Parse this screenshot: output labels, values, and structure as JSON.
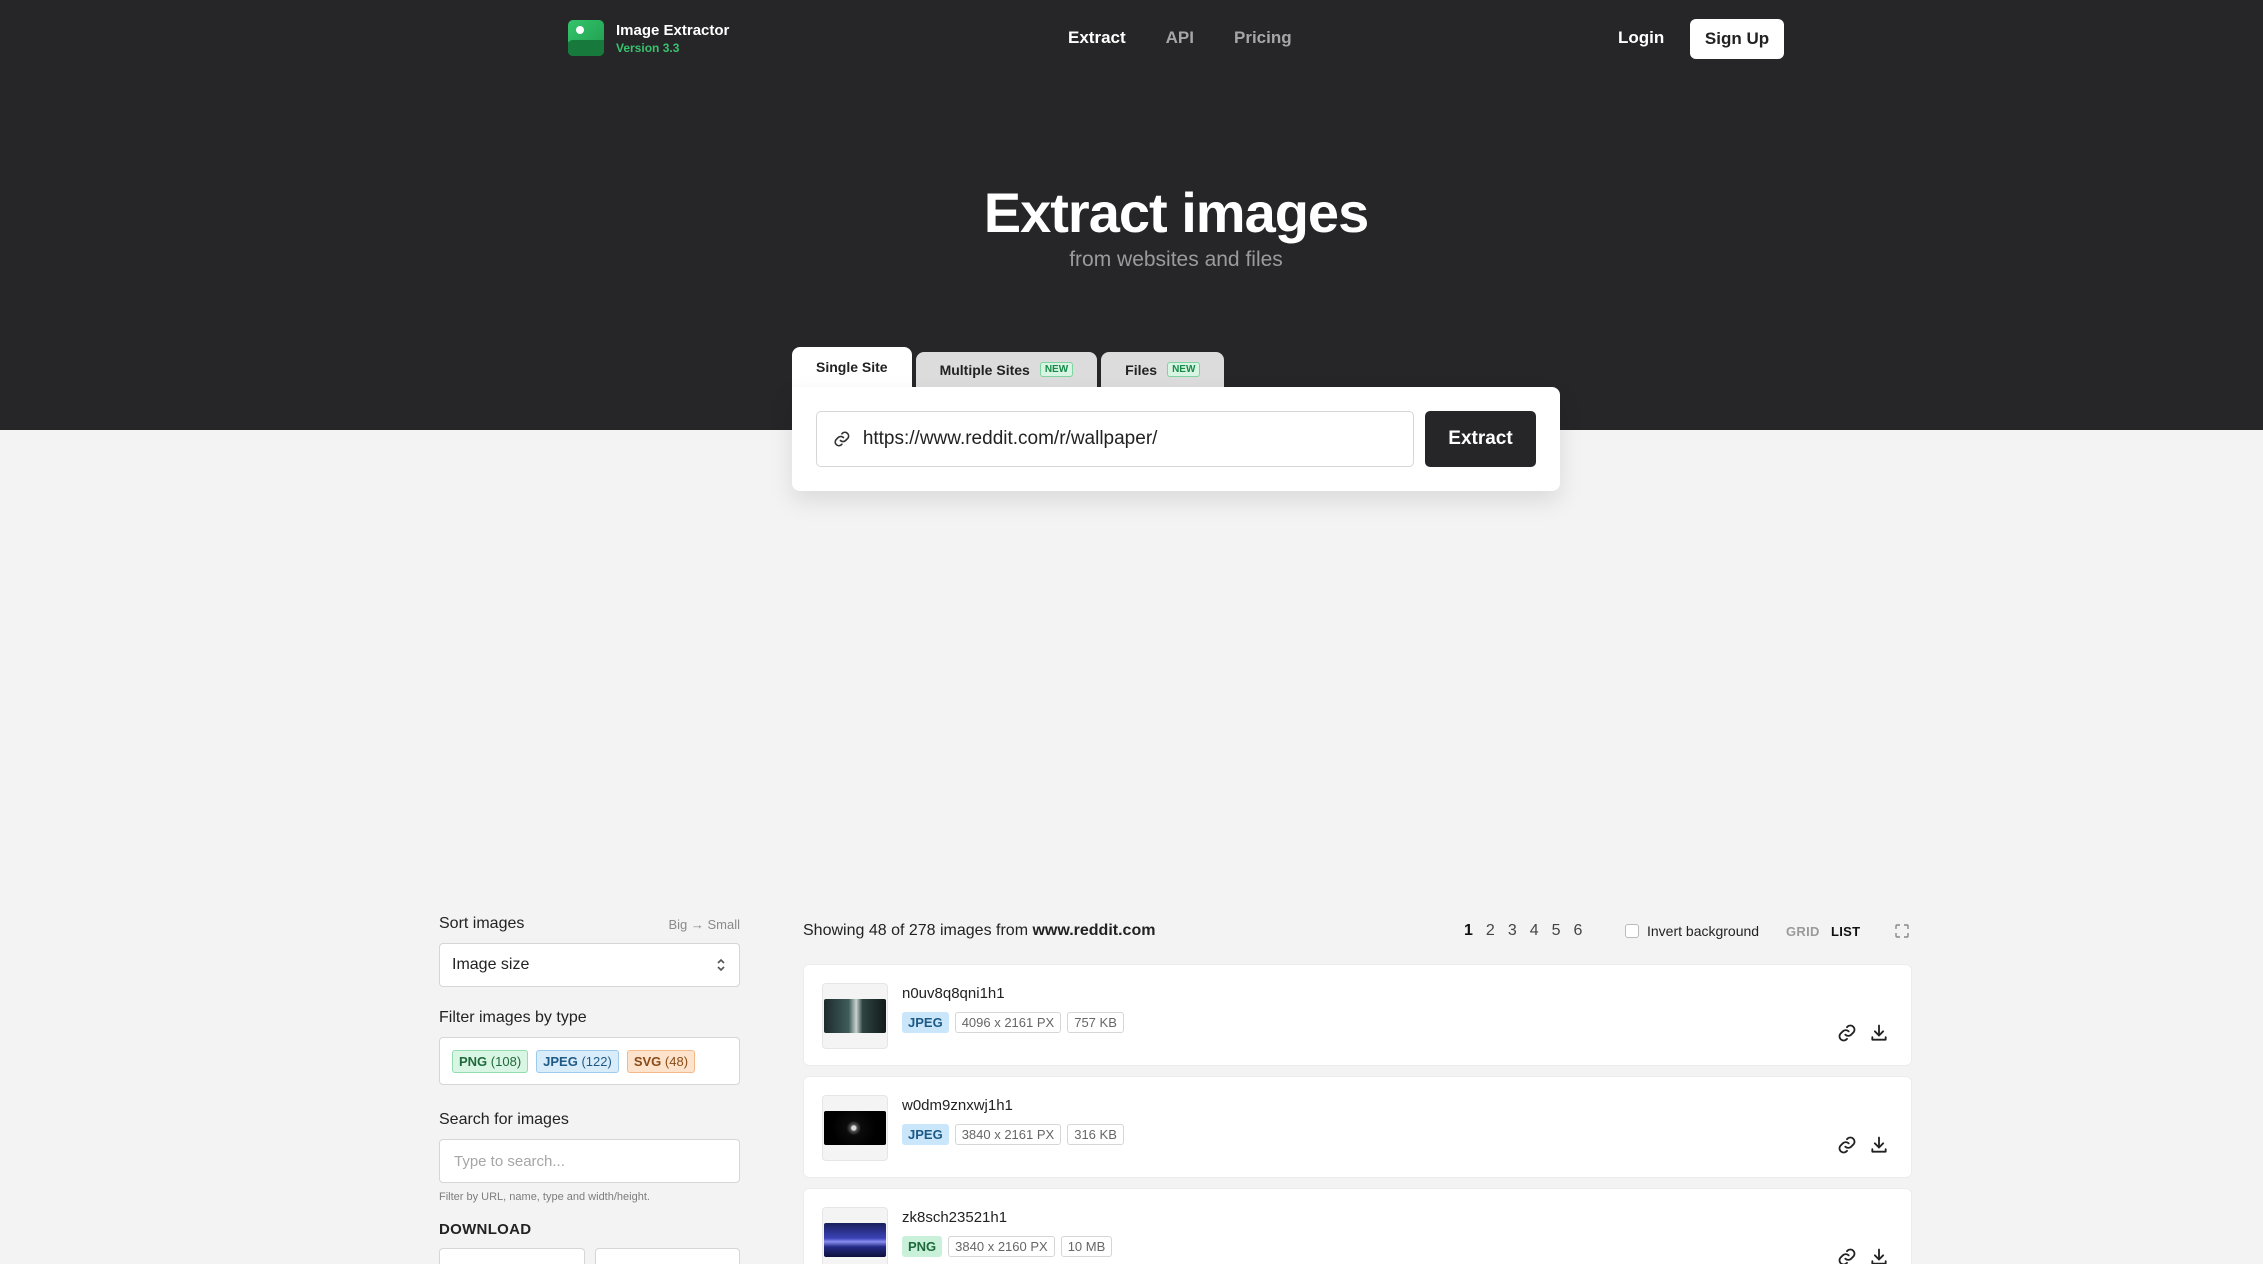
{
  "brand": {
    "name": "Image Extractor",
    "version": "Version 3.3"
  },
  "nav": [
    {
      "label": "Extract",
      "active": true
    },
    {
      "label": "API",
      "active": false
    },
    {
      "label": "Pricing",
      "active": false
    }
  ],
  "auth": {
    "login": "Login",
    "signup": "Sign Up"
  },
  "hero": {
    "title": "Extract images",
    "subtitle": "from websites and files"
  },
  "tabs": [
    {
      "label": "Single Site",
      "badge": ""
    },
    {
      "label": "Multiple Sites",
      "badge": "NEW"
    },
    {
      "label": "Files",
      "badge": "NEW"
    }
  ],
  "extract": {
    "url": "https://www.reddit.com/r/wallpaper/",
    "button": "Extract"
  },
  "sidebar": {
    "sort_label": "Sort images",
    "sort_hint": "Big → Small",
    "sort_value": "Image size",
    "filter_label": "Filter images by type",
    "filters": [
      {
        "type": "PNG",
        "count": "(108)"
      },
      {
        "type": "JPEG",
        "count": "(122)"
      },
      {
        "type": "SVG",
        "count": "(48)"
      }
    ],
    "search_label": "Search for images",
    "search_placeholder": "Type to search...",
    "search_hint": "Filter by URL, name, type and width/height.",
    "download_label": "DOWNLOAD"
  },
  "results": {
    "showing_prefix": "Showing 48 of 278 images from",
    "domain": "www.reddit.com",
    "pages": [
      "1",
      "2",
      "3",
      "4",
      "5",
      "6"
    ],
    "current_page": "1",
    "invert_label": "Invert background",
    "view_grid": "GRID",
    "view_list": "LIST"
  },
  "images": [
    {
      "name": "n0uv8q8qni1h1",
      "type": "JPEG",
      "dims": "4096 x 2161 PX",
      "size": "757 KB"
    },
    {
      "name": "w0dm9znxwj1h1",
      "type": "JPEG",
      "dims": "3840 x 2161 PX",
      "size": "316 KB"
    },
    {
      "name": "zk8sch23521h1",
      "type": "PNG",
      "dims": "3840 x 2160 PX",
      "size": "10 MB"
    }
  ],
  "colors": {
    "hero_bg": "#262628",
    "accent_green": "#37c26e",
    "page_bg": "#f3f3f3"
  }
}
